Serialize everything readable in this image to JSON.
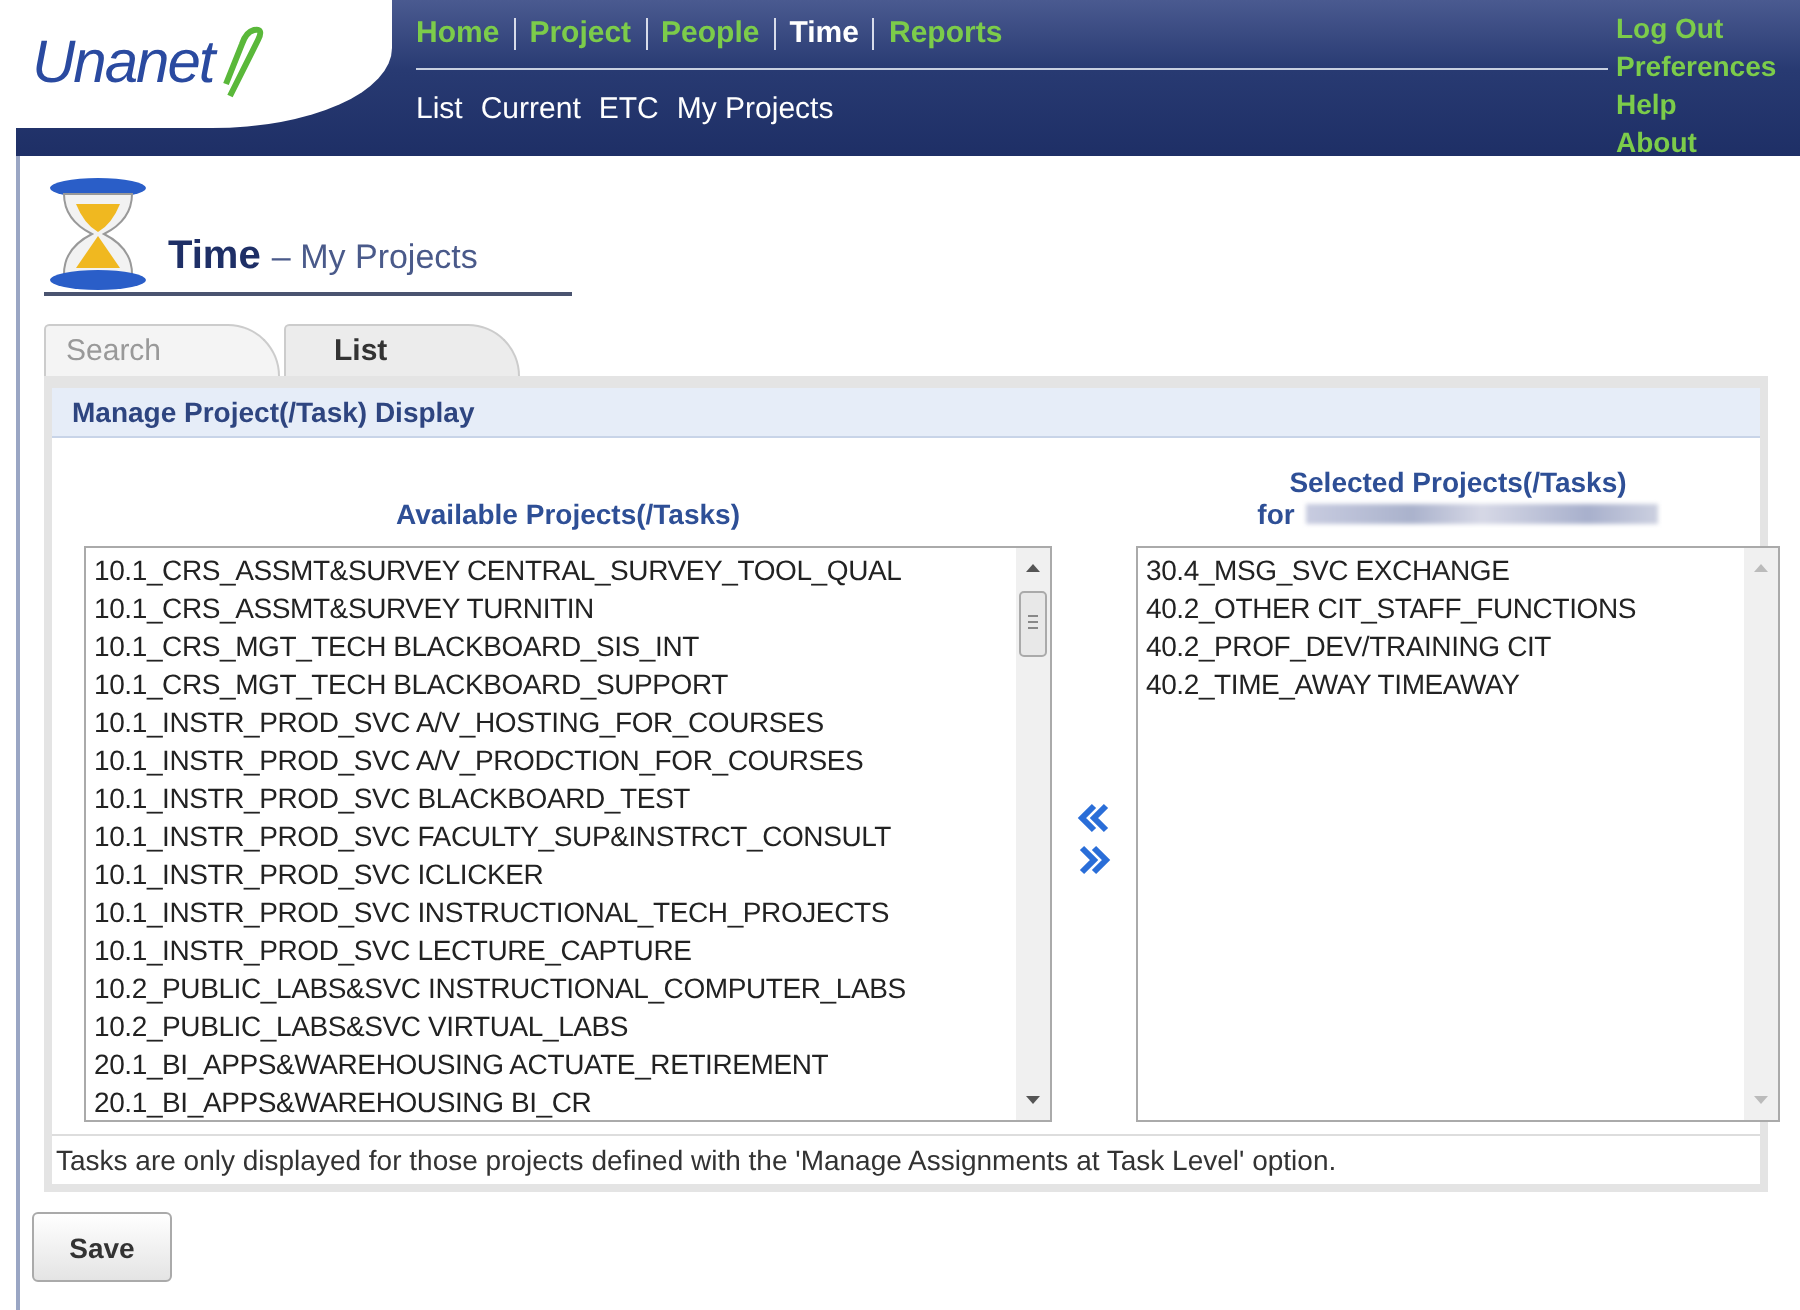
{
  "header": {
    "logo": "Unanet",
    "nav": [
      {
        "label": "Home",
        "selected": false
      },
      {
        "label": "Project",
        "selected": false
      },
      {
        "label": "People",
        "selected": false
      },
      {
        "label": "Time",
        "selected": true
      },
      {
        "label": "Reports",
        "selected": false
      }
    ],
    "subnav": [
      "List",
      "Current",
      "ETC",
      "My Projects"
    ],
    "utility_links": [
      "Log Out",
      "Preferences",
      "Help",
      "About"
    ]
  },
  "page_title": {
    "section": "Time",
    "separator": "–",
    "subtitle": "My Projects"
  },
  "tabs": [
    {
      "label": "Search",
      "selected": false
    },
    {
      "label": "List",
      "selected": true
    }
  ],
  "panel": {
    "title": "Manage Project(/Task) Display",
    "available": {
      "heading": "Available Projects(/Tasks)",
      "items": [
        "10.1_CRS_ASSMT&SURVEY CENTRAL_SURVEY_TOOL_QUAL",
        "10.1_CRS_ASSMT&SURVEY TURNITIN",
        "10.1_CRS_MGT_TECH BLACKBOARD_SIS_INT",
        "10.1_CRS_MGT_TECH BLACKBOARD_SUPPORT",
        "10.1_INSTR_PROD_SVC A/V_HOSTING_FOR_COURSES",
        "10.1_INSTR_PROD_SVC A/V_PRODCTION_FOR_COURSES",
        "10.1_INSTR_PROD_SVC BLACKBOARD_TEST",
        "10.1_INSTR_PROD_SVC FACULTY_SUP&INSTRCT_CONSULT",
        "10.1_INSTR_PROD_SVC ICLICKER",
        "10.1_INSTR_PROD_SVC INSTRUCTIONAL_TECH_PROJECTS",
        "10.1_INSTR_PROD_SVC LECTURE_CAPTURE",
        "10.2_PUBLIC_LABS&SVC INSTRUCTIONAL_COMPUTER_LABS",
        "10.2_PUBLIC_LABS&SVC VIRTUAL_LABS",
        "20.1_BI_APPS&WAREHOUSING ACTUATE_RETIREMENT",
        "20.1_BI_APPS&WAREHOUSING BI_CR"
      ]
    },
    "selected": {
      "heading": "Selected Projects(/Tasks)",
      "for_label": "for",
      "items": [
        "30.4_MSG_SVC EXCHANGE",
        "40.2_OTHER CIT_STAFF_FUNCTIONS",
        "40.2_PROF_DEV/TRAINING CIT",
        "40.2_TIME_AWAY TIMEAWAY"
      ]
    },
    "note": "Tasks are only displayed for those projects defined with the 'Manage Assignments at Task Level' option."
  },
  "save_button": "Save"
}
